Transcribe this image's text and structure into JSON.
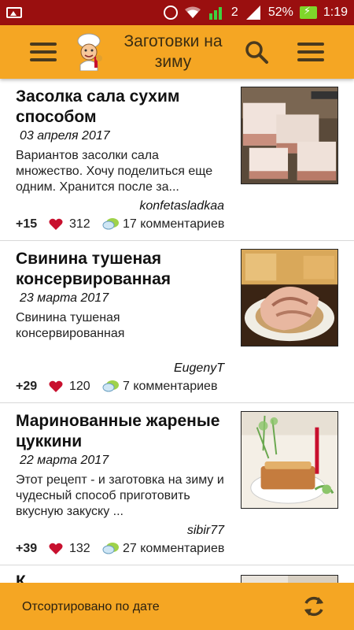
{
  "statusbar": {
    "battery_percent": "52%",
    "time": "1:19",
    "network": "2"
  },
  "toolbar": {
    "title": "Заготовки на зиму",
    "menu_icon": "hamburger-icon",
    "logo_icon": "chef-logo-icon",
    "search_icon": "search-icon",
    "more_icon": "more-menu-icon"
  },
  "posts": [
    {
      "title": "Засолка сала сухим способом",
      "date": "03 апреля 2017",
      "excerpt": "Вариантов засолки сала множество. Хочу поделиться еще одним. Хранится после за...",
      "author": "konfetasladkaa",
      "score": "+15",
      "likes": "312",
      "comments": "17 комментариев",
      "thumb": "salted-lard-photo"
    },
    {
      "title": "Свинина тушеная консервированная",
      "date": "23 марта 2017",
      "excerpt": "Свинина тушеная консервированная",
      "author": "EugenyT",
      "score": "+29",
      "likes": "120",
      "comments": "7 комментариев",
      "thumb": "canned-pork-photo"
    },
    {
      "title": "Маринованные жареные цуккини",
      "date": "22 марта 2017",
      "excerpt": "Этот рецепт - и заготовка на зиму и чудесный способ приготовить вкусную закуску ...",
      "author": "sibir77",
      "score": "+39",
      "likes": "132",
      "comments": "27 комментариев",
      "thumb": "marinated-zucchini-photo"
    },
    {
      "title": "К",
      "thumb": "next-recipe-photo"
    }
  ],
  "bottombar": {
    "sort_label": "Отсортировано по дате",
    "refresh_icon": "refresh-icon"
  },
  "colors": {
    "accent": "#f5a623",
    "statusbar": "#9a0f0f",
    "heart": "#c8102e",
    "text": "#111111"
  }
}
